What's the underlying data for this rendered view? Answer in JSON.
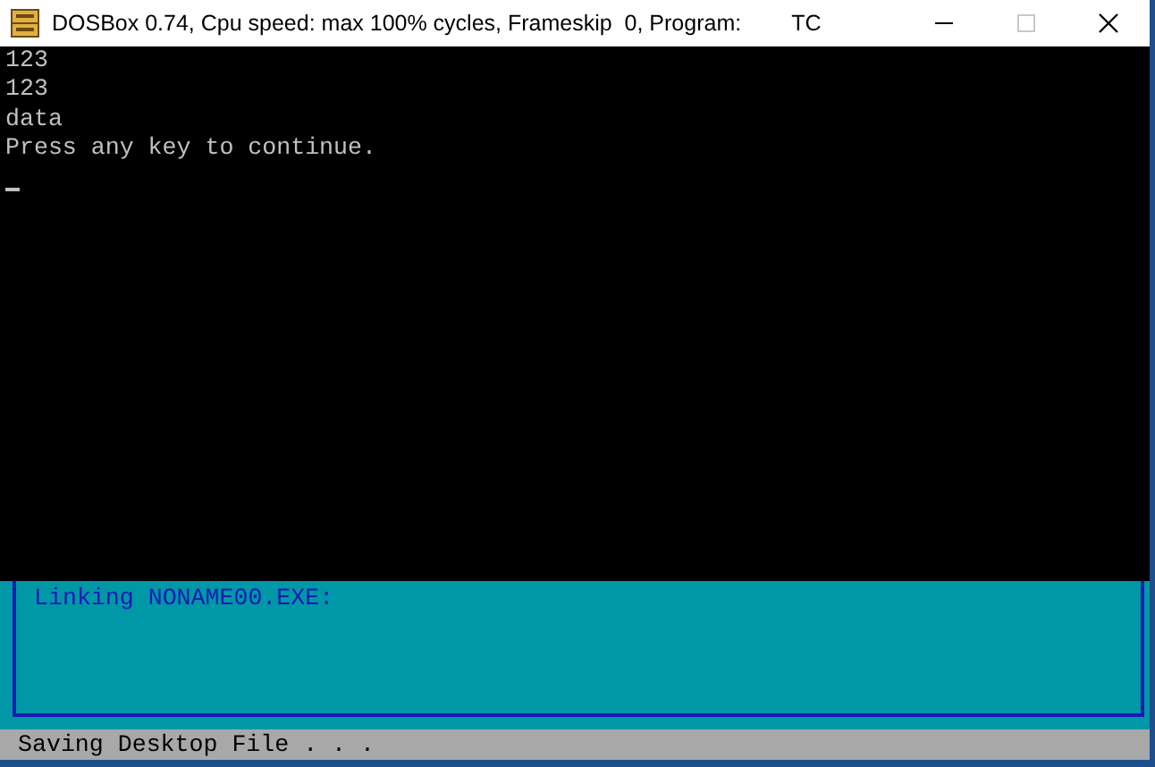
{
  "window": {
    "title": "DOSBox 0.74, Cpu speed: max 100% cycles, Frameskip  0, Program:",
    "program": "TC"
  },
  "console": {
    "lines": [
      "123",
      "123",
      "data",
      "Press any key to continue."
    ],
    "cursor": true
  },
  "background_window": {
    "message_lines": [
      "Linking NONAME00.EXE:"
    ],
    "status_bar": "Saving Desktop File . . ."
  }
}
